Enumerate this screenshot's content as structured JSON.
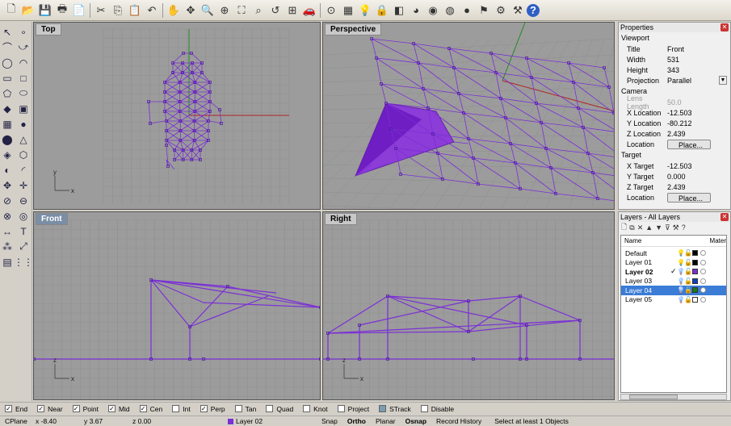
{
  "colors": {
    "viewport_bg": "#9c9c9c",
    "grid": "#8f8f8f",
    "wire": "#7b2fd6",
    "mesh_fill": "#8a2be2",
    "axis_x": "#b22222",
    "axis_y": "#228b22",
    "layer02": "#7b2fd6",
    "layer03": "#1040c0",
    "layer04": "#1a7a1a",
    "selected": "#3a7cd6"
  },
  "toolbar": {
    "icons": [
      "new-icon",
      "open-icon",
      "save-icon",
      "print-icon",
      "import-icon",
      "cut-icon",
      "copy-icon",
      "paste-icon",
      "undo-icon",
      "pan-icon",
      "rotate-view-icon",
      "zoom-icon",
      "zoom-window-icon",
      "zoom-extents-icon",
      "zoom-selected-icon",
      "undo-view-icon",
      "four-viewports-icon",
      "car-icon",
      "set-cplane-icon",
      "grid-icon",
      "light-icon",
      "lock-icon",
      "layer-icon",
      "color-icon",
      "shade-icon",
      "display-icon",
      "render-icon",
      "select-filter-icon",
      "gear-icon",
      "options-icon",
      "help-icon"
    ]
  },
  "viewports": [
    {
      "id": "top",
      "title": "Top",
      "axis_x": "x",
      "axis_y": "y"
    },
    {
      "id": "perspective",
      "title": "Perspective"
    },
    {
      "id": "front",
      "title": "Front",
      "axis_x": "x",
      "axis_y": "z"
    },
    {
      "id": "right",
      "title": "Right",
      "axis_x": "x",
      "axis_y": "z"
    }
  ],
  "properties": {
    "title": "Properties",
    "section": "Viewport",
    "viewport_rows": [
      {
        "key": "Title",
        "value": "Front"
      },
      {
        "key": "Width",
        "value": "531"
      },
      {
        "key": "Height",
        "value": "343"
      },
      {
        "key": "Projection",
        "value": "Parallel"
      }
    ],
    "camera_label": "Camera",
    "camera_rows": [
      {
        "key": "Lens Length",
        "value": "50.0"
      },
      {
        "key": "X Location",
        "value": "-12.503"
      },
      {
        "key": "Y Location",
        "value": "-80.212"
      },
      {
        "key": "Z Location",
        "value": "2.439"
      },
      {
        "key": "Location",
        "value": "Place..."
      }
    ],
    "target_label": "Target",
    "target_rows": [
      {
        "key": "X Target",
        "value": "-12.503"
      },
      {
        "key": "Y Target",
        "value": "0.000"
      },
      {
        "key": "Z Target",
        "value": "2.439"
      },
      {
        "key": "Location",
        "value": "Place..."
      }
    ]
  },
  "layers": {
    "title": "Layers - All Layers",
    "col_name": "Name",
    "col_material": "Mater",
    "rows": [
      {
        "name": "Default",
        "check": "",
        "color": "#000000",
        "current": false,
        "selected": false
      },
      {
        "name": "Layer 01",
        "check": "",
        "color": "#000000",
        "current": false,
        "selected": false
      },
      {
        "name": "Layer 02",
        "check": "✓",
        "color": "#7b2fd6",
        "current": true,
        "selected": false
      },
      {
        "name": "Layer 03",
        "check": "",
        "color": "#1040c0",
        "current": false,
        "selected": false
      },
      {
        "name": "Layer 04",
        "check": "",
        "color": "#1a7a1a",
        "current": false,
        "selected": true
      },
      {
        "name": "Layer 05",
        "check": "",
        "color": "#ffffff",
        "current": false,
        "selected": false
      }
    ]
  },
  "osnap": [
    {
      "label": "End",
      "checked": true
    },
    {
      "label": "Near",
      "checked": true
    },
    {
      "label": "Point",
      "checked": true
    },
    {
      "label": "Mid",
      "checked": true
    },
    {
      "label": "Cen",
      "checked": true
    },
    {
      "label": "Int",
      "checked": false
    },
    {
      "label": "Perp",
      "checked": true
    },
    {
      "label": "Tan",
      "checked": false
    },
    {
      "label": "Quad",
      "checked": false
    },
    {
      "label": "Knot",
      "checked": false
    },
    {
      "label": "Project",
      "checked": false
    },
    {
      "label": "STrack",
      "checked": false
    },
    {
      "label": "Disable",
      "checked": false
    }
  ],
  "status": {
    "cplane": "CPlane",
    "x": "x -8.40",
    "y": "y 3.67",
    "z": "z 0.00",
    "layer": "Layer 02",
    "snap": "Snap",
    "ortho": "Ortho",
    "planar": "Planar",
    "osnap": "Osnap",
    "record": "Record History",
    "message": "Select at least 1 Objects"
  }
}
